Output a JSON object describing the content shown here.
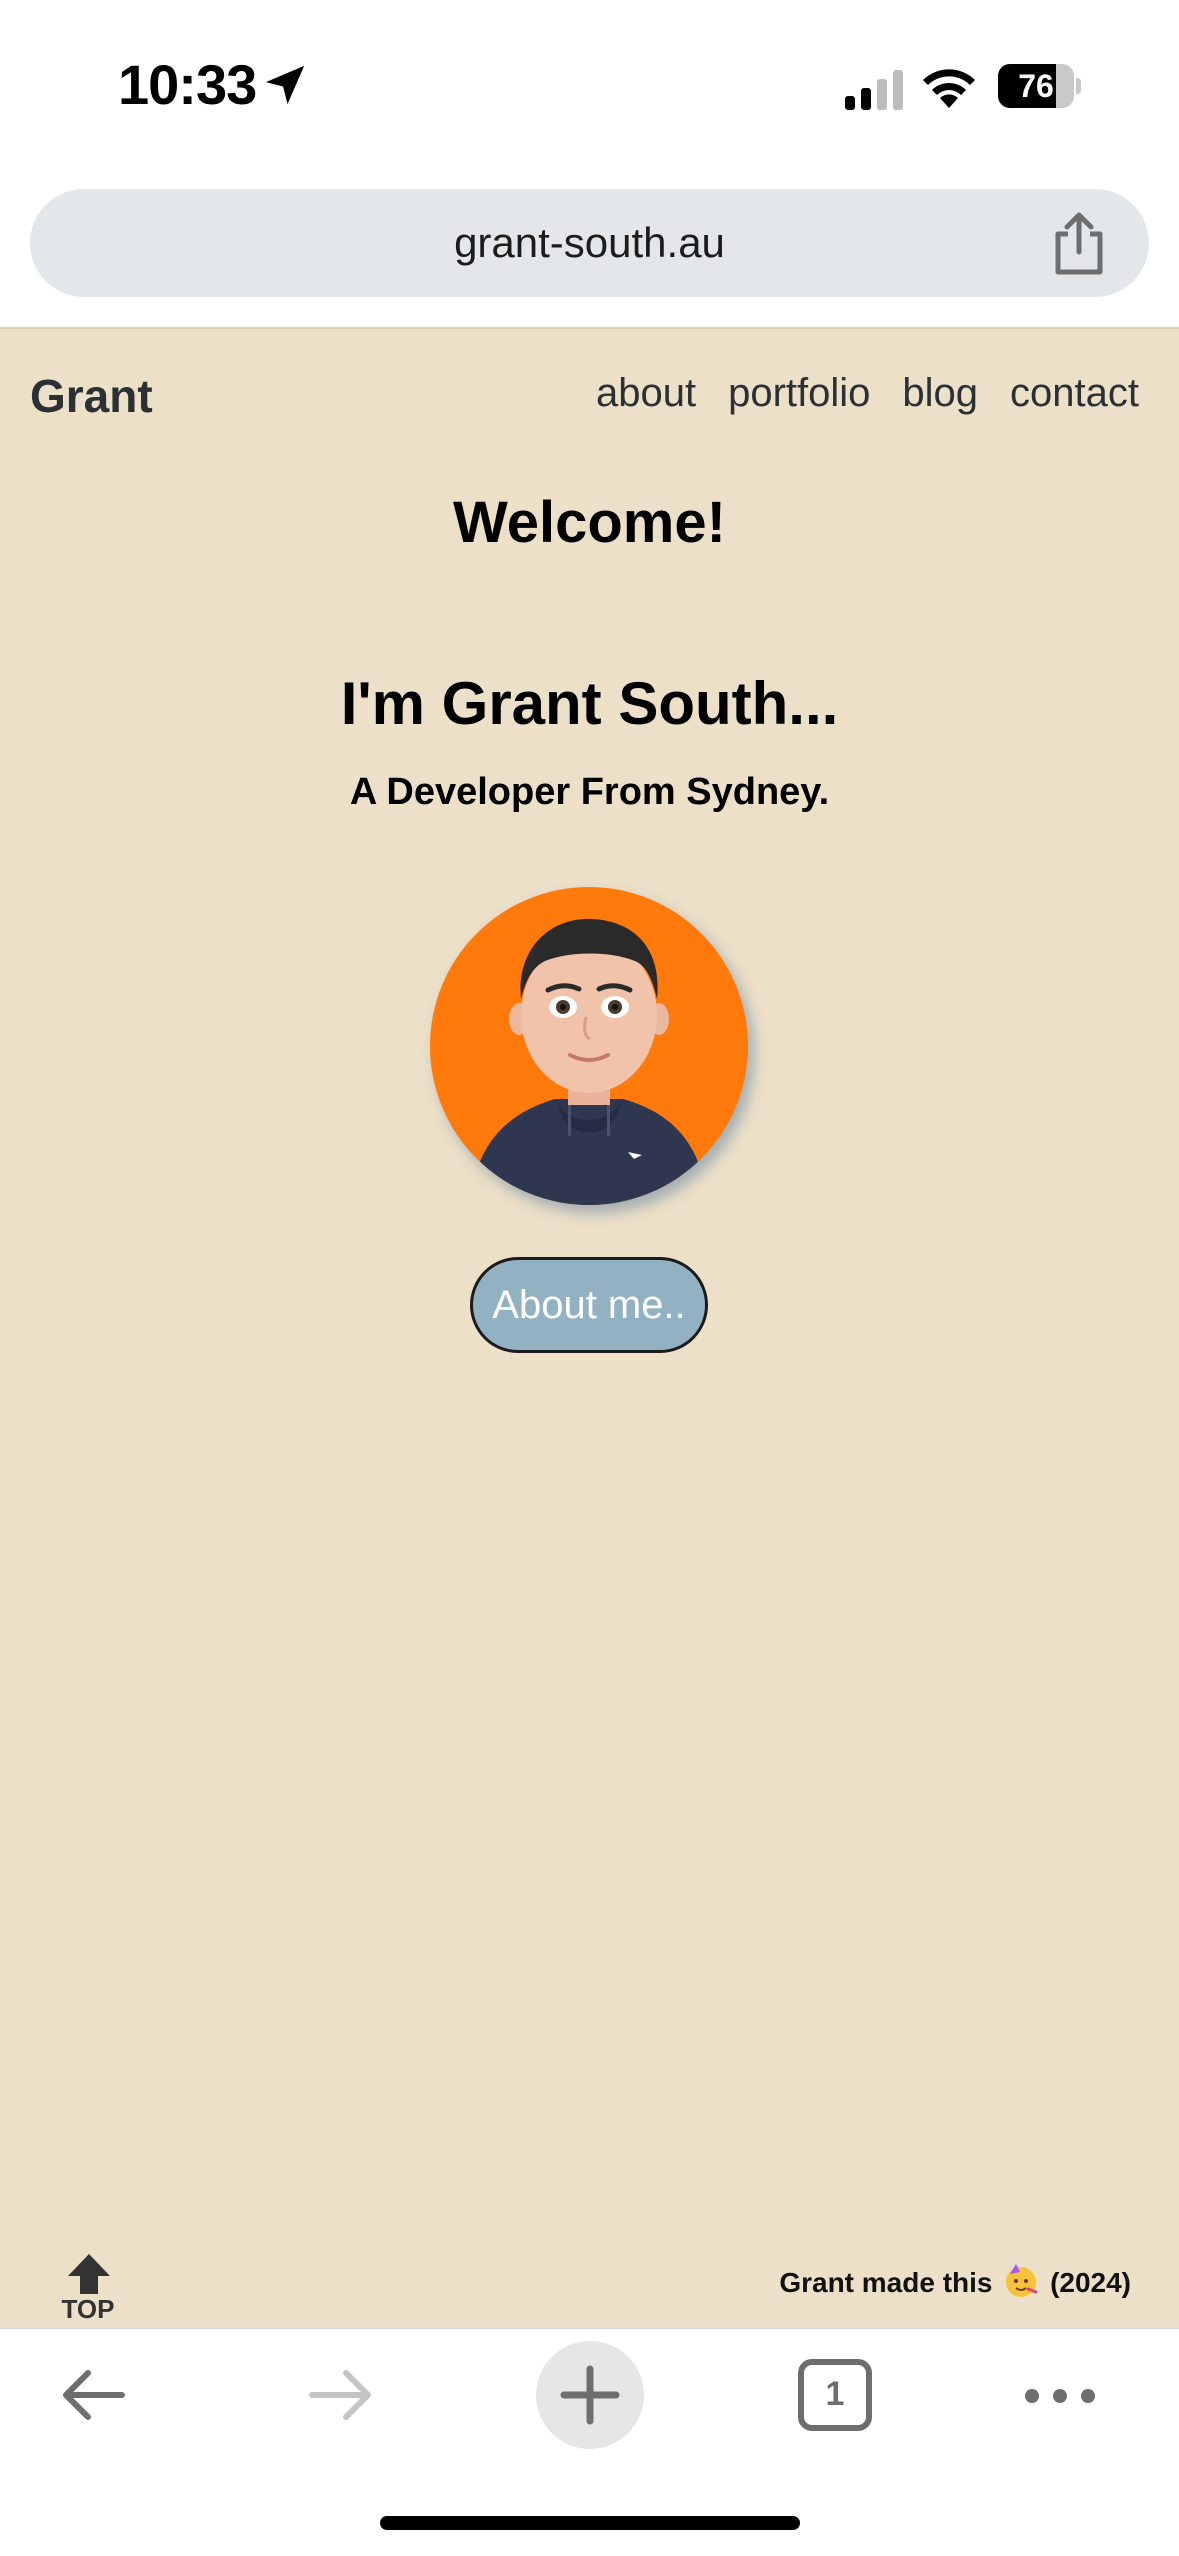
{
  "status_bar": {
    "time": "10:33",
    "battery_level": "76",
    "icons": [
      "location-arrow-icon",
      "cellular-signal-icon",
      "wifi-icon",
      "battery-icon"
    ]
  },
  "browser": {
    "url": "grant-south.au",
    "share_icon": "share-icon"
  },
  "site": {
    "brand": "Grant",
    "nav": [
      "about",
      "portfolio",
      "blog",
      "contact"
    ],
    "welcome": "Welcome!",
    "heading": "I'm Grant South...",
    "subheading": "A Developer From Sydney.",
    "avatar_icon": "memoji-avatar",
    "about_button": "About me..",
    "top_label": "TOP",
    "footer": {
      "text_before": "Grant made this",
      "emoji": "party-face-emoji",
      "text_after": "(2024)"
    },
    "colors": {
      "background": "#ede0c8",
      "button": "#92b2c3",
      "avatar_bg": "#ff7a0a"
    }
  },
  "toolbar": {
    "tab_count": "1",
    "icons": [
      "back-arrow-icon",
      "forward-arrow-icon",
      "plus-icon",
      "tabs-icon",
      "more-icon"
    ]
  }
}
